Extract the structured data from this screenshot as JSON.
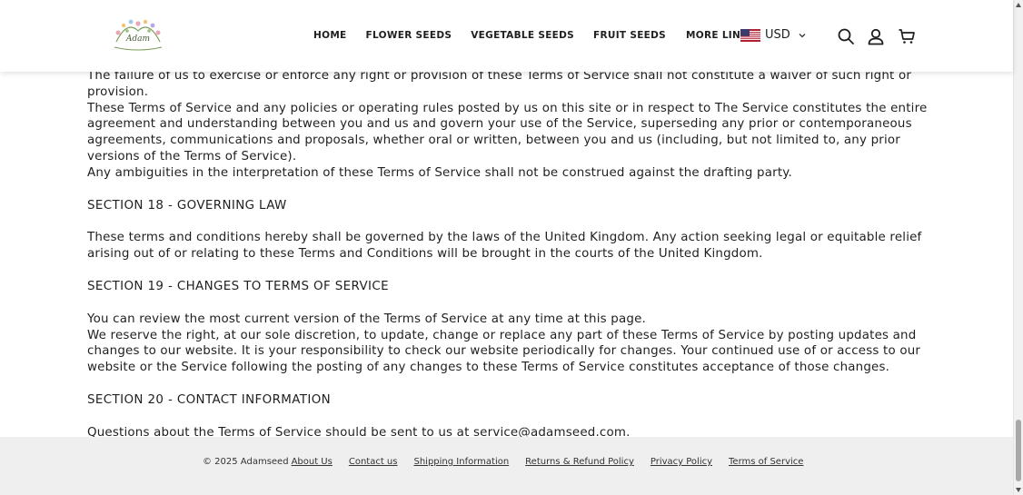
{
  "header": {
    "nav": [
      {
        "label": "HOME"
      },
      {
        "label": "FLOWER SEEDS"
      },
      {
        "label": "VEGETABLE SEEDS"
      },
      {
        "label": "FRUIT SEEDS"
      },
      {
        "label": "MORE LINKS"
      }
    ],
    "currency": {
      "label": "USD",
      "flag": "us-flag-icon"
    },
    "icons": [
      "search-icon",
      "account-icon",
      "cart-icon"
    ],
    "logo_text": "Adam"
  },
  "content": {
    "para1": [
      "The failure of us to exercise or enforce any right or provision of these Terms of Service shall not constitute a waiver of such right or provision.",
      "These Terms of Service and any policies or operating rules posted by us on this site or in respect to The Service constitutes the entire agreement and understanding between you and us and govern your use of the Service, superseding any prior or contemporaneous agreements, communications and proposals, whether oral or written, between you and us (including, but not limited to, any prior versions of the Terms of Service).",
      "Any ambiguities in the interpretation of these Terms of Service shall not be construed against the drafting party."
    ],
    "section18_heading": "SECTION 18 - GOVERNING LAW",
    "section18_text": "These terms and conditions hereby shall be governed by the laws of the United Kingdom. Any action seeking legal or equitable relief arising out of or relating to these Terms and Conditions will be brought in the courts of the United Kingdom.",
    "section19_heading": "SECTION 19 - CHANGES TO TERMS OF SERVICE",
    "section19_text": [
      "You can review the most current version of the Terms of Service at any time at this page.",
      "We reserve the right, at our sole discretion, to update, change or replace any part of these Terms of Service by posting updates and changes to our website. It is your responsibility to check our website periodically for changes. Your continued use of or access to our website or the Service following the posting of any changes to these Terms of Service constitutes acceptance of those changes."
    ],
    "section20_heading": "SECTION 20 - CONTACT INFORMATION",
    "section20_text": "Questions about the Terms of Service should be sent to us at service@adamseed.com."
  },
  "footer": {
    "copyright": "© 2025 Adamseed",
    "links": [
      {
        "label": "About Us"
      },
      {
        "label": "Contact us"
      },
      {
        "label": "Shipping Information"
      },
      {
        "label": "Returns & Refund Policy"
      },
      {
        "label": "Privacy Policy"
      },
      {
        "label": "Terms of Service"
      }
    ]
  },
  "colors": {
    "text": "#1f1f1f",
    "footer_bg": "#efefef",
    "header_bg": "#ffffff"
  }
}
